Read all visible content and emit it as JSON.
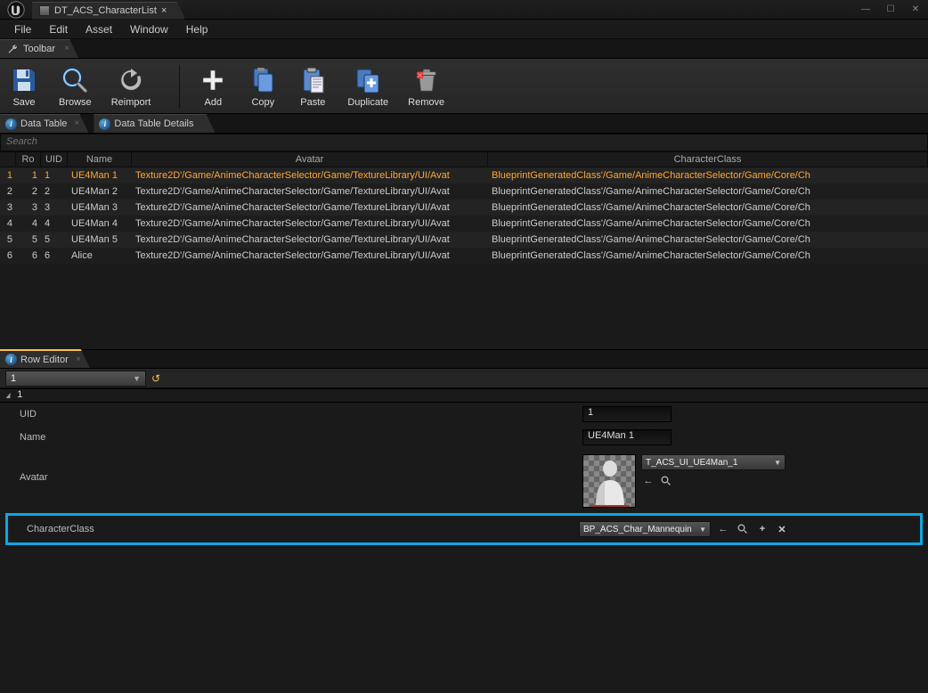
{
  "window": {
    "title": "DT_ACS_CharacterList"
  },
  "menu": {
    "file": "File",
    "edit": "Edit",
    "asset": "Asset",
    "window": "Window",
    "help": "Help"
  },
  "toolbar_tab": "Toolbar",
  "toolbar": {
    "save": "Save",
    "browse": "Browse",
    "reimport": "Reimport",
    "add": "Add",
    "copy": "Copy",
    "paste": "Paste",
    "duplicate": "Duplicate",
    "remove": "Remove"
  },
  "panel_tabs": {
    "data_table": "Data Table",
    "data_table_details": "Data Table Details"
  },
  "search_placeholder": "Search",
  "table": {
    "headers": {
      "row": "Ro",
      "uid": "UID",
      "name": "Name",
      "avatar": "Avatar",
      "cclass": "CharacterClass"
    },
    "rows": [
      {
        "idx": "1",
        "row": "1",
        "uid": "1",
        "name": "UE4Man 1",
        "avatar": "Texture2D'/Game/AnimeCharacterSelector/Game/TextureLibrary/UI/Avat",
        "cclass": "BlueprintGeneratedClass'/Game/AnimeCharacterSelector/Game/Core/Ch"
      },
      {
        "idx": "2",
        "row": "2",
        "uid": "2",
        "name": "UE4Man 2",
        "avatar": "Texture2D'/Game/AnimeCharacterSelector/Game/TextureLibrary/UI/Avat",
        "cclass": "BlueprintGeneratedClass'/Game/AnimeCharacterSelector/Game/Core/Ch"
      },
      {
        "idx": "3",
        "row": "3",
        "uid": "3",
        "name": "UE4Man 3",
        "avatar": "Texture2D'/Game/AnimeCharacterSelector/Game/TextureLibrary/UI/Avat",
        "cclass": "BlueprintGeneratedClass'/Game/AnimeCharacterSelector/Game/Core/Ch"
      },
      {
        "idx": "4",
        "row": "4",
        "uid": "4",
        "name": "UE4Man 4",
        "avatar": "Texture2D'/Game/AnimeCharacterSelector/Game/TextureLibrary/UI/Avat",
        "cclass": "BlueprintGeneratedClass'/Game/AnimeCharacterSelector/Game/Core/Ch"
      },
      {
        "idx": "5",
        "row": "5",
        "uid": "5",
        "name": "UE4Man 5",
        "avatar": "Texture2D'/Game/AnimeCharacterSelector/Game/TextureLibrary/UI/Avat",
        "cclass": "BlueprintGeneratedClass'/Game/AnimeCharacterSelector/Game/Core/Ch"
      },
      {
        "idx": "6",
        "row": "6",
        "uid": "6",
        "name": "Alice",
        "avatar": "Texture2D'/Game/AnimeCharacterSelector/Game/TextureLibrary/UI/Avat",
        "cclass": "BlueprintGeneratedClass'/Game/AnimeCharacterSelector/Game/Core/Ch"
      }
    ]
  },
  "row_editor": {
    "tab": "Row Editor",
    "selected": "1",
    "section": "1",
    "fields": {
      "uid_label": "UID",
      "uid_val": "1",
      "name_label": "Name",
      "name_val": "UE4Man 1",
      "avatar_label": "Avatar",
      "avatar_asset": "T_ACS_UI_UE4Man_1",
      "cclass_label": "CharacterClass",
      "cclass_val": "BP_ACS_Char_Mannequin"
    }
  },
  "colors": {
    "accent": "#0aa8e6",
    "highlight": "#ffa733"
  }
}
